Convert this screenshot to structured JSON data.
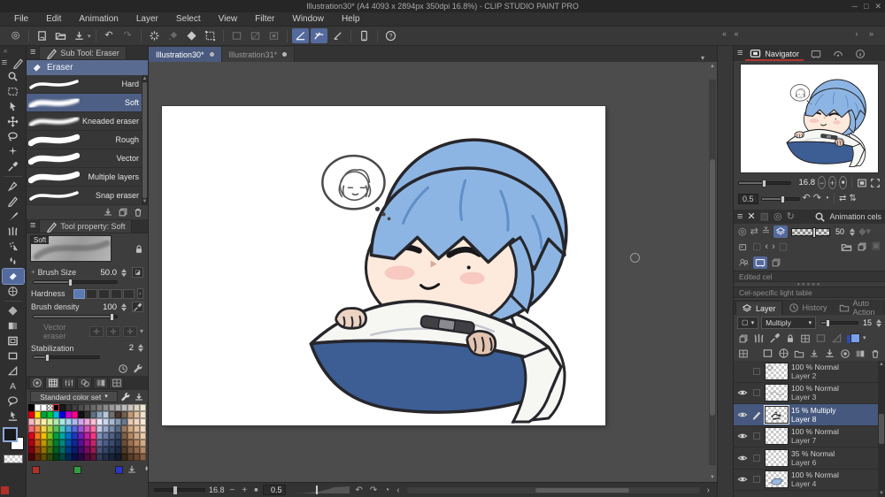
{
  "window": {
    "title": "Illustration30* (A4 4093 x 2894px 350dpi 16.8%)  - CLIP STUDIO PAINT PRO",
    "controls": [
      {
        "name": "minimize"
      },
      {
        "name": "maximize"
      },
      {
        "name": "close"
      }
    ]
  },
  "menu": {
    "items": [
      "File",
      "Edit",
      "Animation",
      "Layer",
      "Select",
      "View",
      "Filter",
      "Window",
      "Help"
    ]
  },
  "toolbar": {
    "buttons": [
      {
        "name": "clip-studio-home",
        "icon": "logo"
      },
      {
        "sep": true
      },
      {
        "name": "new-document",
        "icon": "new-doc"
      },
      {
        "name": "open-file",
        "icon": "folder-open"
      },
      {
        "name": "export",
        "icon": "export",
        "dropdown": true
      },
      {
        "sep": true
      },
      {
        "name": "undo",
        "icon": "undo"
      },
      {
        "name": "redo",
        "icon": "redo",
        "disabled": true
      },
      {
        "sep": true
      },
      {
        "name": "processing",
        "icon": "spinner"
      },
      {
        "name": "fill",
        "icon": "fill",
        "disabled": true
      },
      {
        "name": "gradient",
        "icon": "diamond"
      },
      {
        "name": "crop-canvas",
        "icon": "crop"
      },
      {
        "sep": true
      },
      {
        "name": "selection-rect",
        "icon": "sel1",
        "disabled": true
      },
      {
        "name": "selection-invert",
        "icon": "sel2",
        "disabled": true
      },
      {
        "name": "selection-border",
        "icon": "sel3",
        "disabled": true
      },
      {
        "sep": true
      },
      {
        "name": "snap-to-ruler",
        "icon": "snap1",
        "active": true
      },
      {
        "name": "snap-to-special-ruler",
        "icon": "snap2",
        "active": true
      },
      {
        "name": "snap-to-grid",
        "icon": "snap3"
      },
      {
        "sep": true
      },
      {
        "name": "tablet-mode",
        "icon": "tablet"
      },
      {
        "sep": true
      },
      {
        "name": "help",
        "icon": "help"
      }
    ]
  },
  "document_tabs": [
    {
      "label": "Illustration30*",
      "active": true
    },
    {
      "label": "Illustration31*",
      "active": false
    }
  ],
  "tool_column": {
    "tools": [
      {
        "name": "zoom",
        "icon": "magnifier"
      },
      {
        "name": "marquee-select",
        "icon": "marquee"
      },
      {
        "name": "operation",
        "icon": "object"
      },
      {
        "name": "move",
        "icon": "move"
      },
      {
        "name": "lasso-select",
        "icon": "lasso"
      },
      {
        "name": "auto-select",
        "icon": "wand"
      },
      {
        "name": "eyedropper",
        "icon": "eyedropper"
      },
      {
        "div": true
      },
      {
        "name": "pen",
        "icon": "pen"
      },
      {
        "name": "pencil",
        "icon": "pencil"
      },
      {
        "name": "brush",
        "icon": "brush"
      },
      {
        "name": "decoration",
        "icon": "grass"
      },
      {
        "name": "airbrush",
        "icon": "airbrush"
      },
      {
        "name": "blend",
        "icon": "blend"
      },
      {
        "name": "eraser",
        "icon": "eraser-tool",
        "selected": true
      },
      {
        "name": "figure",
        "icon": "figure"
      },
      {
        "div": true
      },
      {
        "name": "gradient-tool",
        "icon": "grad-diamond"
      },
      {
        "name": "tone",
        "icon": "grad-square"
      },
      {
        "name": "frame-border",
        "icon": "frame"
      },
      {
        "name": "rectangle",
        "icon": "rect-tool"
      },
      {
        "name": "ruler",
        "icon": "ruler-tri"
      },
      {
        "name": "text",
        "icon": "text-tool"
      },
      {
        "name": "balloon",
        "icon": "balloon"
      },
      {
        "name": "select-layer",
        "icon": "select-layer"
      }
    ]
  },
  "sub_tool": {
    "title": "Sub Tool: Eraser",
    "group_label": "Eraser",
    "items": [
      {
        "label": "Hard",
        "stroke": "hard"
      },
      {
        "label": "Soft",
        "stroke": "soft",
        "selected": true
      },
      {
        "label": "Kneaded eraser",
        "stroke": "kneaded"
      },
      {
        "label": "Rough",
        "stroke": "rough"
      },
      {
        "label": "Vector",
        "stroke": "rough"
      },
      {
        "label": "Multiple layers",
        "stroke": "rough"
      },
      {
        "label": "Snap eraser",
        "stroke": "hard"
      }
    ]
  },
  "tool_property": {
    "title": "Tool property: Soft",
    "preview_label": "Soft",
    "brush_size": {
      "label": "Brush Size",
      "value": "50.0",
      "percent": 42
    },
    "hardness": {
      "label": "Hardness",
      "segments": 5,
      "active_segment": 1
    },
    "brush_density": {
      "label": "Brush density",
      "value": "100",
      "percent": 92
    },
    "vector_eraser": {
      "label": "Vector eraser"
    },
    "stabilization": {
      "label": "Stabilization",
      "value": "2",
      "percent": 18
    }
  },
  "color_set": {
    "name": "Standard color set",
    "selected": {
      "row": 0,
      "col": 4
    },
    "history": [
      "#b03028",
      "#2f9e3f",
      "#2b35c8"
    ],
    "rows": [
      [
        "#000000",
        "#ffffff",
        "#ffffff",
        "CHECKER",
        "#000000",
        "#1a1a1a",
        "#333333",
        "#404040",
        "#4d4d4d",
        "#5a5a5a",
        "#6a6a6a",
        "#7a7a7a",
        "#8a8a8a",
        "#9a9a9a",
        "#ababab",
        "#bcbcbc",
        "#cdc5bd",
        "#ded2c4",
        "#efe6d8"
      ],
      [
        "#e60012",
        "#ffe100",
        "#00a040",
        "#00c830",
        "#00b8d8",
        "#0000e0",
        "#c800c8",
        "#ff0090",
        "#101010",
        "#303030",
        "#607080",
        "#90a8c0",
        "#b8c8d8",
        "#707070",
        "#4a3830",
        "#706050",
        "#c09878",
        "#dcc0a0",
        "#f0e0cc"
      ],
      [
        "#f8b8c0",
        "#f8d8a8",
        "#f8f0a8",
        "#d8f0a0",
        "#b0e8b0",
        "#a8e8e0",
        "#a8d0f0",
        "#b0b8f0",
        "#d0a8e8",
        "#f0a8d8",
        "#f8c0d0",
        "#e8e8f8",
        "#c8d8f0",
        "#a8b8d0",
        "#8898b0",
        "#687890",
        "#e8c8b0",
        "#f0d8c0",
        "#f8e8d8"
      ],
      [
        "#f06878",
        "#f09048",
        "#f0d048",
        "#a8d048",
        "#58c058",
        "#48c8b8",
        "#4898e0",
        "#5868d8",
        "#9858d0",
        "#d858b8",
        "#f070a0",
        "#c0c8e0",
        "#98a8c8",
        "#788aa8",
        "#586880",
        "#9a7860",
        "#d0a880",
        "#e0c0a0",
        "#f0d8c0"
      ],
      [
        "#e00020",
        "#f07820",
        "#f0c000",
        "#80c020",
        "#00a040",
        "#00a8a0",
        "#0070d0",
        "#2038c0",
        "#7020b0",
        "#c020a0",
        "#f03880",
        "#8090b8",
        "#687ba0",
        "#506080",
        "#384a68",
        "#806048",
        "#b08860",
        "#d0a888",
        "#e8cbaa"
      ],
      [
        "#b00018",
        "#c05810",
        "#c09800",
        "#609018",
        "#008030",
        "#008880",
        "#0050a8",
        "#102898",
        "#581090",
        "#a01080",
        "#c02868",
        "#607098",
        "#4a5c88",
        "#3a4a70",
        "#2a3a58",
        "#684c38",
        "#987050",
        "#b88868",
        "#d0ab88"
      ],
      [
        "#800010",
        "#904008",
        "#907000",
        "#487010",
        "#006024",
        "#006860",
        "#003c80",
        "#0c1c70",
        "#400c68",
        "#780c60",
        "#901e4c",
        "#485478",
        "#364468",
        "#283858",
        "#1c2a44",
        "#503a28",
        "#785840",
        "#906848",
        "#b08868"
      ],
      [
        "#500008",
        "#602c04",
        "#604c00",
        "#304c08",
        "#004018",
        "#004840",
        "#002858",
        "#060f48",
        "#280844",
        "#500840",
        "#601432",
        "#303c58",
        "#242e48",
        "#1a2438",
        "#121c2c",
        "#382818",
        "#583c28",
        "#684834",
        "#886048"
      ]
    ]
  },
  "canvas": {
    "zoom": "16.8",
    "rotation": "0.5"
  },
  "navigator": {
    "title": "Navigator",
    "zoom_value": "16.8",
    "rotation_value": "0.5"
  },
  "animation": {
    "title": "Animation cels",
    "opacity_value": "50",
    "edited_cel_label": "Edited cel",
    "light_table_label": "Cel-specific light table"
  },
  "layer_panel": {
    "tabs": [
      {
        "label": "Layer",
        "active": true
      },
      {
        "label": "History",
        "active": false
      },
      {
        "label": "Auto Action",
        "active": false
      }
    ],
    "blend_mode": "Multiply",
    "opacity": "15",
    "layers": [
      {
        "name": "Layer 2",
        "info": "100 % Normal",
        "visible": false,
        "editing": false,
        "selected": false,
        "thumb": "sketch"
      },
      {
        "name": "Layer 3",
        "info": "100 % Normal",
        "visible": true,
        "editing": false,
        "selected": false,
        "thumb": "faint"
      },
      {
        "name": "Layer 8",
        "info": "15 % Multiply",
        "visible": true,
        "editing": true,
        "selected": true,
        "thumb": "dark"
      },
      {
        "name": "Layer 7",
        "info": "100 % Normal",
        "visible": true,
        "editing": false,
        "selected": false,
        "thumb": "empty"
      },
      {
        "name": "Layer 6",
        "info": "35 % Normal",
        "visible": true,
        "editing": false,
        "selected": false,
        "thumb": "empty"
      },
      {
        "name": "Layer 4",
        "info": "100 % Normal",
        "visible": true,
        "editing": false,
        "selected": false,
        "thumb": "blue"
      }
    ]
  },
  "colors": {
    "accent_selection": "#54699c",
    "tab_active": "#4a5a7e",
    "navigator_underline": "#b23430",
    "hair_blue": "#8db5e3",
    "blanket_blue": "#3c5e95",
    "skin": "#fdeadc"
  }
}
